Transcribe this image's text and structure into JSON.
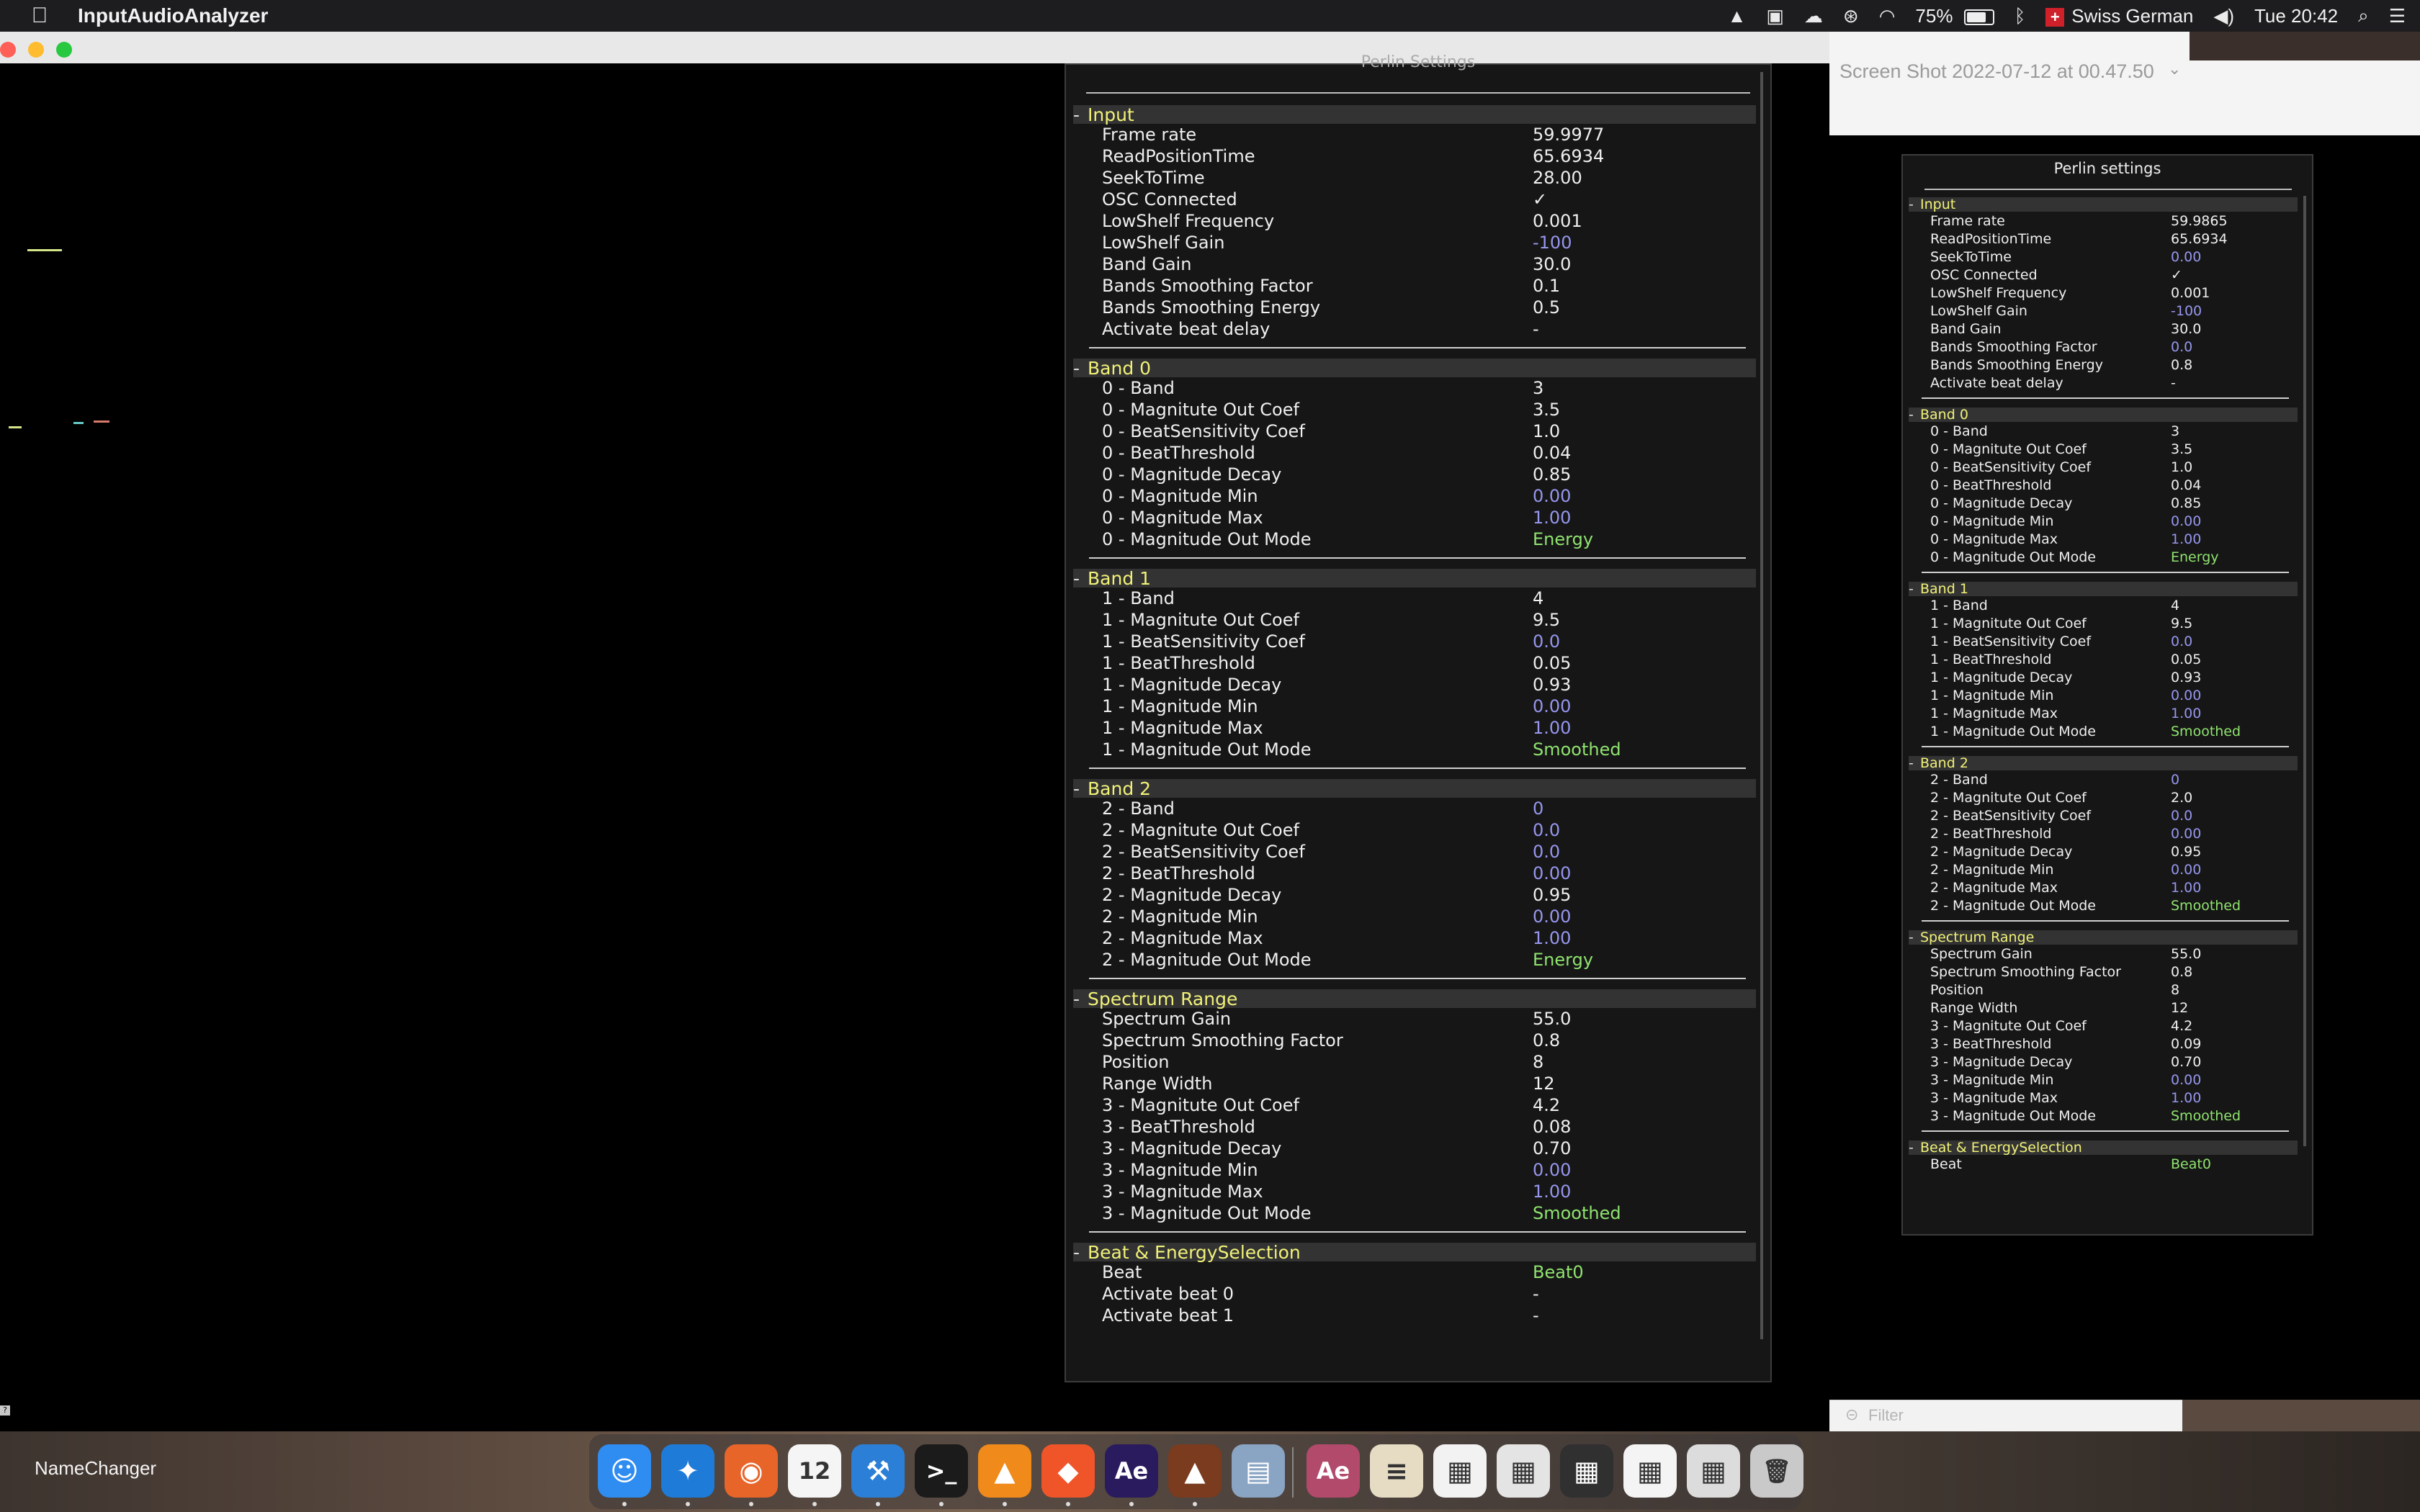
{
  "menubar": {
    "app_name": "InputAudioAnalyzer",
    "battery": "75%",
    "input_source": "Swiss German",
    "clock": "Tue 20:42",
    "icons": [
      "apple-icon",
      "vlc-icon",
      "screens-icon",
      "cloud-icon",
      "accessibility-icon",
      "wifi-icon",
      "battery-icon",
      "bluetooth-icon",
      "swiss-flag-icon",
      "volume-icon",
      "search-icon",
      "control-center-icon"
    ]
  },
  "finder": {
    "window_title": "Screen Shot 2022-07-12 at 00.47.50",
    "filter_placeholder": "Filter"
  },
  "big_panel": {
    "title": "Perlin Settings",
    "sections": [
      {
        "name": "Input",
        "rows": [
          {
            "label": "Frame rate",
            "value": "59.9977",
            "color": "w"
          },
          {
            "label": "ReadPositionTime",
            "value": "65.6934",
            "color": "w"
          },
          {
            "label": "SeekToTime",
            "value": "28.00",
            "color": "w"
          },
          {
            "label": "OSC Connected",
            "value": "✓",
            "color": "w"
          },
          {
            "label": "LowShelf Frequency",
            "value": "0.001",
            "color": "w"
          },
          {
            "label": "LowShelf Gain",
            "value": "-100",
            "color": "b"
          },
          {
            "label": "Band Gain",
            "value": "30.0",
            "color": "w"
          },
          {
            "label": "Bands Smoothing Factor",
            "value": "0.1",
            "color": "w"
          },
          {
            "label": "Bands Smoothing Energy",
            "value": "0.5",
            "color": "w"
          },
          {
            "label": "Activate beat delay",
            "value": "-",
            "color": "w"
          }
        ]
      },
      {
        "name": "Band 0",
        "rows": [
          {
            "label": "0 - Band",
            "value": "3",
            "color": "w"
          },
          {
            "label": "0 - Magnitute Out Coef",
            "value": "3.5",
            "color": "w"
          },
          {
            "label": "0 - BeatSensitivity Coef",
            "value": "1.0",
            "color": "w"
          },
          {
            "label": "0 - BeatThreshold",
            "value": "0.04",
            "color": "w"
          },
          {
            "label": "0 - Magnitude Decay",
            "value": "0.85",
            "color": "w"
          },
          {
            "label": "0 - Magnitude Min",
            "value": "0.00",
            "color": "b"
          },
          {
            "label": "0 - Magnitude Max",
            "value": "1.00",
            "color": "b"
          },
          {
            "label": "0 - Magnitude Out Mode",
            "value": "Energy",
            "color": "g"
          }
        ]
      },
      {
        "name": "Band 1",
        "rows": [
          {
            "label": "1 - Band",
            "value": "4",
            "color": "w"
          },
          {
            "label": "1 - Magnitute Out Coef",
            "value": "9.5",
            "color": "w"
          },
          {
            "label": "1 - BeatSensitivity Coef",
            "value": "0.0",
            "color": "b"
          },
          {
            "label": "1 - BeatThreshold",
            "value": "0.05",
            "color": "w"
          },
          {
            "label": "1 - Magnitude Decay",
            "value": "0.93",
            "color": "w"
          },
          {
            "label": "1 - Magnitude Min",
            "value": "0.00",
            "color": "b"
          },
          {
            "label": "1 - Magnitude Max",
            "value": "1.00",
            "color": "b"
          },
          {
            "label": "1 - Magnitude Out Mode",
            "value": "Smoothed",
            "color": "g"
          }
        ]
      },
      {
        "name": "Band 2",
        "rows": [
          {
            "label": "2 - Band",
            "value": "0",
            "color": "b"
          },
          {
            "label": "2 - Magnitute Out Coef",
            "value": "0.0",
            "color": "b"
          },
          {
            "label": "2 - BeatSensitivity Coef",
            "value": "0.0",
            "color": "b"
          },
          {
            "label": "2 - BeatThreshold",
            "value": "0.00",
            "color": "b"
          },
          {
            "label": "2 - Magnitude Decay",
            "value": "0.95",
            "color": "w"
          },
          {
            "label": "2 - Magnitude Min",
            "value": "0.00",
            "color": "b"
          },
          {
            "label": "2 - Magnitude Max",
            "value": "1.00",
            "color": "b"
          },
          {
            "label": "2 - Magnitude Out Mode",
            "value": "Energy",
            "color": "g"
          }
        ]
      },
      {
        "name": "Spectrum Range",
        "rows": [
          {
            "label": "Spectrum Gain",
            "value": "55.0",
            "color": "w"
          },
          {
            "label": "Spectrum Smoothing Factor",
            "value": "0.8",
            "color": "w"
          },
          {
            "label": "Position",
            "value": "8",
            "color": "w"
          },
          {
            "label": "Range Width",
            "value": "12",
            "color": "w"
          },
          {
            "label": "3 - Magnitute Out Coef",
            "value": "4.2",
            "color": "w"
          },
          {
            "label": "3 - BeatThreshold",
            "value": "0.08",
            "color": "w"
          },
          {
            "label": "3 - Magnitude Decay",
            "value": "0.70",
            "color": "w"
          },
          {
            "label": "3 - Magnitude Min",
            "value": "0.00",
            "color": "b"
          },
          {
            "label": "3 - Magnitude Max",
            "value": "1.00",
            "color": "b"
          },
          {
            "label": "3 - Magnitude Out Mode",
            "value": "Smoothed",
            "color": "g"
          }
        ]
      },
      {
        "name": "Beat & EnergySelection",
        "rows": [
          {
            "label": "Beat",
            "value": "Beat0",
            "color": "g"
          },
          {
            "label": "Activate beat 0",
            "value": "-",
            "color": "w"
          },
          {
            "label": "Activate beat 1",
            "value": "-",
            "color": "w"
          }
        ]
      }
    ]
  },
  "small_panel": {
    "title": "Perlin settings",
    "sections": [
      {
        "name": "Input",
        "rows": [
          {
            "label": "Frame rate",
            "value": "59.9865",
            "color": "w"
          },
          {
            "label": "ReadPositionTime",
            "value": "65.6934",
            "color": "w"
          },
          {
            "label": "SeekToTime",
            "value": "0.00",
            "color": "b"
          },
          {
            "label": "OSC Connected",
            "value": "✓",
            "color": "w"
          },
          {
            "label": "LowShelf Frequency",
            "value": "0.001",
            "color": "w"
          },
          {
            "label": "LowShelf Gain",
            "value": "-100",
            "color": "b"
          },
          {
            "label": "Band Gain",
            "value": "30.0",
            "color": "w"
          },
          {
            "label": "Bands Smoothing Factor",
            "value": "0.0",
            "color": "b"
          },
          {
            "label": "Bands Smoothing Energy",
            "value": "0.8",
            "color": "w"
          },
          {
            "label": "Activate beat delay",
            "value": "-",
            "color": "w"
          }
        ]
      },
      {
        "name": "Band 0",
        "rows": [
          {
            "label": "0 - Band",
            "value": "3",
            "color": "w"
          },
          {
            "label": "0 - Magnitute Out Coef",
            "value": "3.5",
            "color": "w"
          },
          {
            "label": "0 - BeatSensitivity Coef",
            "value": "1.0",
            "color": "w"
          },
          {
            "label": "0 - BeatThreshold",
            "value": "0.04",
            "color": "w"
          },
          {
            "label": "0 - Magnitude Decay",
            "value": "0.85",
            "color": "w"
          },
          {
            "label": "0 - Magnitude Min",
            "value": "0.00",
            "color": "b"
          },
          {
            "label": "0 - Magnitude Max",
            "value": "1.00",
            "color": "b"
          },
          {
            "label": "0 - Magnitude Out Mode",
            "value": "Energy",
            "color": "g"
          }
        ]
      },
      {
        "name": "Band 1",
        "rows": [
          {
            "label": "1 - Band",
            "value": "4",
            "color": "w"
          },
          {
            "label": "1 - Magnitute Out Coef",
            "value": "9.5",
            "color": "w"
          },
          {
            "label": "1 - BeatSensitivity Coef",
            "value": "0.0",
            "color": "b"
          },
          {
            "label": "1 - BeatThreshold",
            "value": "0.05",
            "color": "w"
          },
          {
            "label": "1 - Magnitude Decay",
            "value": "0.93",
            "color": "w"
          },
          {
            "label": "1 - Magnitude Min",
            "value": "0.00",
            "color": "b"
          },
          {
            "label": "1 - Magnitude Max",
            "value": "1.00",
            "color": "b"
          },
          {
            "label": "1 - Magnitude Out Mode",
            "value": "Smoothed",
            "color": "g"
          }
        ]
      },
      {
        "name": "Band 2",
        "rows": [
          {
            "label": "2 - Band",
            "value": "0",
            "color": "b"
          },
          {
            "label": "2 - Magnitute Out Coef",
            "value": "2.0",
            "color": "w"
          },
          {
            "label": "2 - BeatSensitivity Coef",
            "value": "0.0",
            "color": "b"
          },
          {
            "label": "2 - BeatThreshold",
            "value": "0.00",
            "color": "b"
          },
          {
            "label": "2 - Magnitude Decay",
            "value": "0.95",
            "color": "w"
          },
          {
            "label": "2 - Magnitude Min",
            "value": "0.00",
            "color": "b"
          },
          {
            "label": "2 - Magnitude Max",
            "value": "1.00",
            "color": "b"
          },
          {
            "label": "2 - Magnitude Out Mode",
            "value": "Smoothed",
            "color": "g"
          }
        ]
      },
      {
        "name": "Spectrum Range",
        "rows": [
          {
            "label": "Spectrum Gain",
            "value": "55.0",
            "color": "w"
          },
          {
            "label": "Spectrum Smoothing Factor",
            "value": "0.8",
            "color": "w"
          },
          {
            "label": "Position",
            "value": "8",
            "color": "w"
          },
          {
            "label": "Range Width",
            "value": "12",
            "color": "w"
          },
          {
            "label": "3 - Magnitute Out Coef",
            "value": "4.2",
            "color": "w"
          },
          {
            "label": "3 - BeatThreshold",
            "value": "0.09",
            "color": "w"
          },
          {
            "label": "3 - Magnitude Decay",
            "value": "0.70",
            "color": "w"
          },
          {
            "label": "3 - Magnitude Min",
            "value": "0.00",
            "color": "b"
          },
          {
            "label": "3 - Magnitude Max",
            "value": "1.00",
            "color": "b"
          },
          {
            "label": "3 - Magnitude Out Mode",
            "value": "Smoothed",
            "color": "g"
          }
        ]
      },
      {
        "name": "Beat & EnergySelection",
        "rows": [
          {
            "label": "Beat",
            "value": "Beat0",
            "color": "g"
          }
        ]
      }
    ]
  },
  "desktop": {
    "namechanger_label": "NameChanger"
  },
  "dock": {
    "items": [
      {
        "name": "finder-icon",
        "glyph": "☺",
        "bg": "#2f8cf0"
      },
      {
        "name": "safari-icon",
        "glyph": "✦",
        "bg": "#1e7bd8"
      },
      {
        "name": "firefox-icon",
        "glyph": "◉",
        "bg": "#e8652a"
      },
      {
        "name": "calendar-icon",
        "glyph": "12",
        "bg": "#f5f5f5"
      },
      {
        "name": "xcode-icon",
        "glyph": "⚒",
        "bg": "#2c7fd6"
      },
      {
        "name": "terminal-icon",
        "glyph": ">_",
        "bg": "#1b1b1b"
      },
      {
        "name": "vlc-icon",
        "glyph": "▲",
        "bg": "#f08a1a"
      },
      {
        "name": "brave-icon",
        "glyph": "◆",
        "bg": "#f0552a"
      },
      {
        "name": "after-effects-icon",
        "glyph": "Ae",
        "bg": "#2a1a5e"
      },
      {
        "name": "app-volcano-icon",
        "glyph": "▲",
        "bg": "#7a3b1e"
      },
      {
        "name": "preview-icon",
        "glyph": "▤",
        "bg": "#8aa4c4"
      },
      {
        "name": "adobe-folder-icon",
        "glyph": "Ae",
        "bg": "#b24a6b"
      },
      {
        "name": "notes-doc-icon",
        "glyph": "≡",
        "bg": "#e6dcc4"
      },
      {
        "name": "window-thumb-icon",
        "glyph": "▦",
        "bg": "#f2f2f2"
      },
      {
        "name": "window-thumb-2-icon",
        "glyph": "▦",
        "bg": "#e4e4e4"
      },
      {
        "name": "window-thumb-3-icon",
        "glyph": "▦",
        "bg": "#303030"
      },
      {
        "name": "window-thumb-4-icon",
        "glyph": "▦",
        "bg": "#f4f4f4"
      },
      {
        "name": "window-thumb-5-icon",
        "glyph": "▦",
        "bg": "#dcdcdc"
      },
      {
        "name": "trash-icon",
        "glyph": "🗑",
        "bg": "#c9c9c9"
      }
    ]
  }
}
